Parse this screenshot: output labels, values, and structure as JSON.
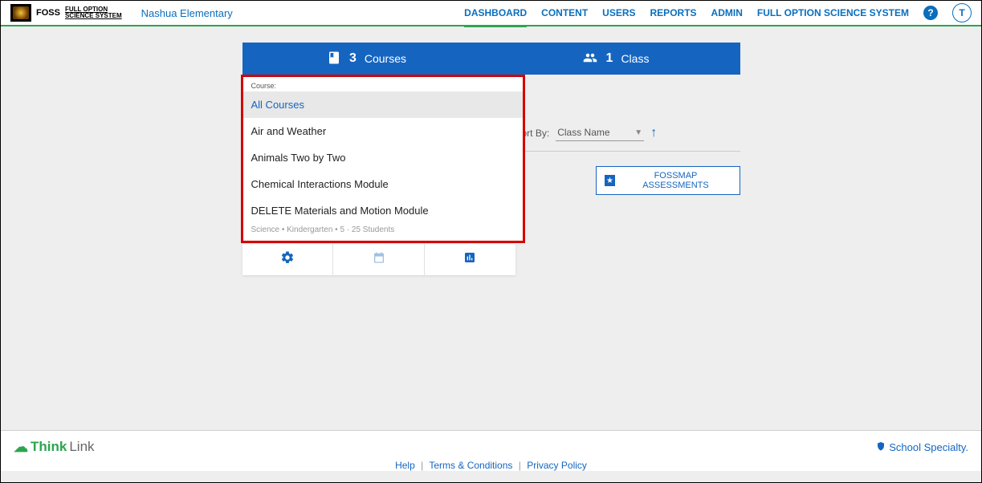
{
  "header": {
    "logo_main": "FOSS",
    "logo_sub1": "FULL OPTION",
    "logo_sub2": "SCIENCE SYSTEM",
    "school": "Nashua Elementary",
    "nav": {
      "dashboard": "DASHBOARD",
      "content": "CONTENT",
      "users": "USERS",
      "reports": "REPORTS",
      "admin": "ADMIN",
      "foss": "FULL OPTION SCIENCE SYSTEM"
    },
    "avatar_initial": "T"
  },
  "tabs": {
    "courses_count": "3",
    "courses_label": "Courses",
    "class_count": "1",
    "class_label": "Class"
  },
  "dropdown": {
    "label": "Course:",
    "items": {
      "0": "All Courses",
      "1": "Air and Weather",
      "2": "Animals Two by Two",
      "3": "Chemical Interactions Module",
      "4": "DELETE Materials and Motion Module"
    },
    "truncated": "Science • Kindergarten • 5 · 25 Students"
  },
  "sort": {
    "label": "Sort By:",
    "value": "Class Name"
  },
  "fossmap_button": "FOSSMAP ASSESSMENTS",
  "footer": {
    "brand_think": "Think",
    "brand_link": "Link",
    "school_specialty": "School Specialty.",
    "help": "Help",
    "terms": "Terms & Conditions",
    "privacy": "Privacy Policy"
  }
}
